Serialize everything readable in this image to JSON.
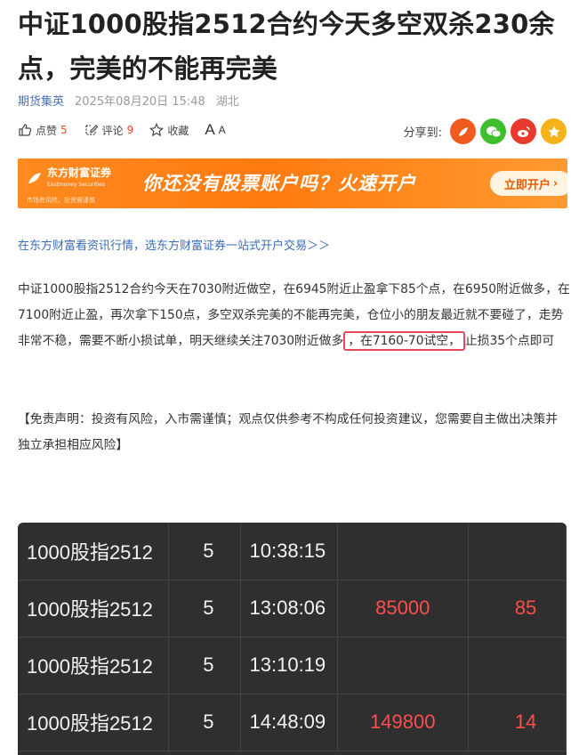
{
  "article": {
    "title": "中证1000股指2512合约今天多空双杀230余点，完美的不能再完美",
    "author": "期货集英",
    "datetime": "2025年08月20日 15:48",
    "location": "湖北"
  },
  "actions": {
    "like_label": "点赞",
    "like_count": "5",
    "comment_label": "评论",
    "comment_count": "9",
    "favorite_label": "收藏",
    "fontsize_label_big": "A",
    "fontsize_label_small": "A"
  },
  "share": {
    "label": "分享到:",
    "icons": [
      "share-circle-icon",
      "wechat-icon",
      "weibo-icon",
      "qzone-star-icon"
    ],
    "colors": [
      "#f05a1e",
      "#3fbf2d",
      "#e83a2c",
      "#f5b21a"
    ]
  },
  "banner": {
    "brand": "东方财富证券",
    "brand_en": "Eastmoney Securities",
    "risk_note": "市场有风险，投资需谨慎",
    "slogan": "你还没有股票账户吗？火速开户",
    "cta": "立即开户",
    "cta_arrow": "›",
    "colors": {
      "bg": "#ff7a10",
      "cta_text": "#e85a00"
    }
  },
  "promo_link": "在东方财富看资讯行情，选东方财富证券一站式开户交易＞＞",
  "body": {
    "before": "中证1000股指2512合约今天在7030附近做空，在6945附近止盈拿下85个点，在6950附近做多，在7100附近止盈，再次拿下150点，多空双杀完美的不能再完美，仓位小的朋友最近就不要碰了，走势非常不稳，需要不断小损试单，明天继续关注7030附近做多",
    "highlight": "，在7160-70试空，",
    "after": "止损35个点即可"
  },
  "disclaimer": "【免责声明：投资有风险，入市需谨慎；观点仅供参考不构成任何投资建议，您需要自主做出决策并独立承担相应风险】",
  "trades": {
    "rows": [
      {
        "contract": "1000股指2512",
        "qty": "5",
        "time": "10:38:15",
        "price1": "",
        "price2": ""
      },
      {
        "contract": "1000股指2512",
        "qty": "5",
        "time": "13:08:06",
        "price1": "85000",
        "price2": "85"
      },
      {
        "contract": "1000股指2512",
        "qty": "5",
        "time": "13:10:19",
        "price1": "",
        "price2": ""
      },
      {
        "contract": "1000股指2512",
        "qty": "5",
        "time": "14:48:09",
        "price1": "149800",
        "price2": "14"
      }
    ]
  }
}
